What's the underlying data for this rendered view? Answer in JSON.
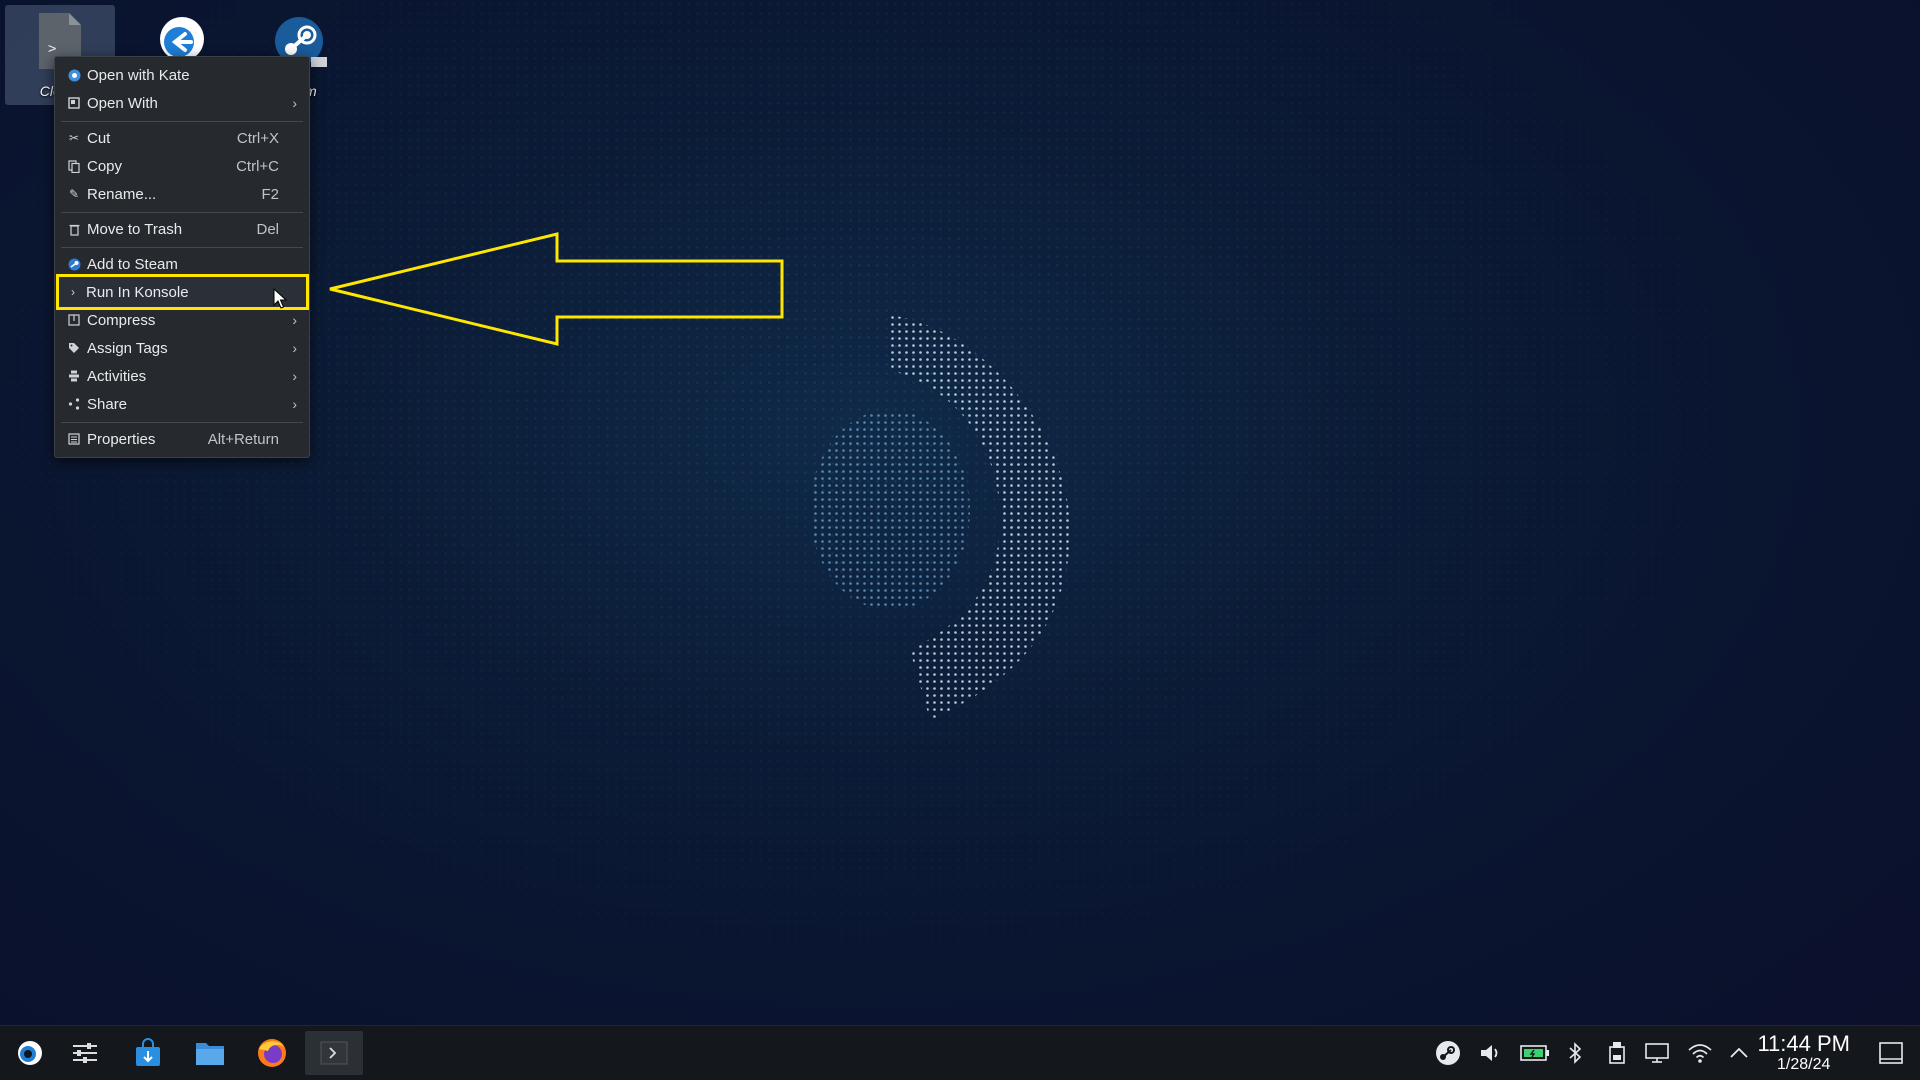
{
  "desktop": {
    "icons": [
      {
        "label": "Clover",
        "icon": "script-file-icon",
        "selected": true
      },
      {
        "label": "",
        "icon": "return-to-gaming-mode-icon"
      },
      {
        "label": "m",
        "icon": "steam-icon"
      }
    ]
  },
  "context_menu": {
    "items": [
      {
        "label": "Open with Kate",
        "shortcut": "",
        "icon": "kate-icon",
        "submenu": false
      },
      {
        "label": "Open With",
        "shortcut": "",
        "icon": "open-with-icon",
        "submenu": true
      },
      {
        "label": "Cut",
        "shortcut": "Ctrl+X",
        "icon": "scissors-icon",
        "submenu": false
      },
      {
        "label": "Copy",
        "shortcut": "Ctrl+C",
        "icon": "copy-icon",
        "submenu": false
      },
      {
        "label": "Rename...",
        "shortcut": "F2",
        "icon": "pencil-icon",
        "submenu": false
      },
      {
        "label": "Move to Trash",
        "shortcut": "Del",
        "icon": "trash-icon",
        "submenu": false
      },
      {
        "label": "Add to Steam",
        "shortcut": "",
        "icon": "steam-icon",
        "submenu": false
      },
      {
        "label": "Run In Konsole",
        "shortcut": "",
        "icon": "terminal-icon",
        "submenu": false,
        "highlighted": true
      },
      {
        "label": "Compress",
        "shortcut": "",
        "icon": "archive-icon",
        "submenu": true
      },
      {
        "label": "Assign Tags",
        "shortcut": "",
        "icon": "tag-icon",
        "submenu": true
      },
      {
        "label": "Activities",
        "shortcut": "",
        "icon": "activities-icon",
        "submenu": true
      },
      {
        "label": "Share",
        "shortcut": "",
        "icon": "share-icon",
        "submenu": true
      },
      {
        "label": "Properties",
        "shortcut": "Alt+Return",
        "icon": "properties-icon",
        "submenu": false
      }
    ],
    "submenu_arrow": "›"
  },
  "annotation": {
    "color": "#ffe600",
    "shape": "left-arrow"
  },
  "taskbar": {
    "launchers": [
      "steamos-menu-icon",
      "mixer-settings-icon",
      "discover-store-icon",
      "dolphin-files-icon",
      "firefox-icon",
      "konsole-icon"
    ],
    "tray": [
      "steam-tray-icon",
      "volume-icon",
      "battery-icon",
      "bluetooth-icon",
      "storage-icon",
      "display-icon",
      "wifi-icon",
      "expand-tray-icon"
    ],
    "clock": {
      "time": "11:44 PM",
      "date": "1/28/24"
    },
    "show_desktop_icon": "show-desktop-icon"
  }
}
